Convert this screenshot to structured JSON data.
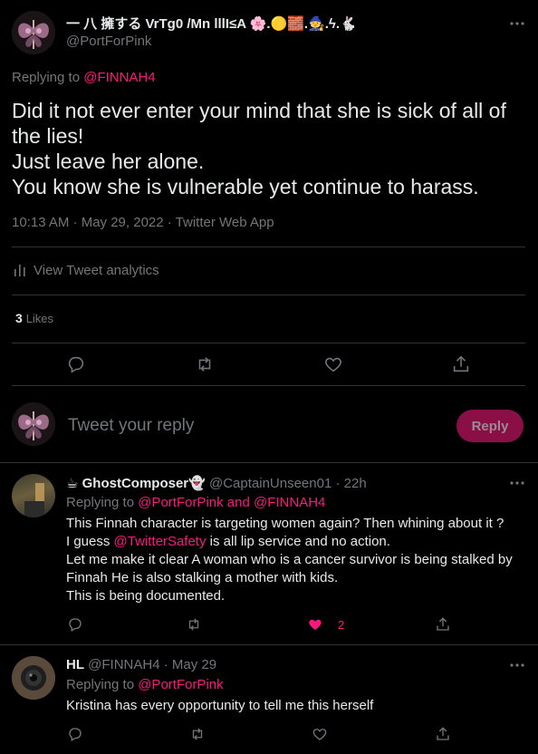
{
  "main_tweet": {
    "display_name": "一 八 擁する VrTg0 /Mn lllI≤A 🌸.🟡🧱.🧙.ϟ.🐇",
    "handle": "@PortForPink",
    "replying_prefix": "Replying to",
    "replying_handle": "@FINNAH4",
    "text_lines": [
      "Did it not ever enter your mind that she is sick of all of",
      "the lies!",
      "Just leave her alone.",
      "You know she is vulnerable yet continue to harass."
    ],
    "meta": "10:13 AM · May 29, 2022 · Twitter Web App",
    "analytics_label": "View Tweet analytics",
    "likes_count": "3",
    "likes_label": "Likes"
  },
  "composer": {
    "placeholder": "Tweet your reply",
    "reply_button": "Reply"
  },
  "replies": [
    {
      "emoji_prefix": "☕",
      "display_name": "GhostComposer👻",
      "handle": "@CaptainUnseen01",
      "time": "· 22h",
      "replying_prefix": "Replying to",
      "replying_handles": "@PortForPink and @FINNAH4",
      "line1": "This Finnah character is targeting women again? Then whining about it ?",
      "line2_pre": "I guess",
      "line2_link": "@TwitterSafety",
      "line2_post": "is all lip service and no action.",
      "line3": "Let me make it clear A woman who is a cancer survivor is being stalked by",
      "line4": "Finnah He is also stalking a mother with kids.",
      "line5": "This is being documented.",
      "like_count": "2",
      "liked": true
    },
    {
      "display_name": "HL",
      "handle": "@FINNAH4",
      "time": "· May 29",
      "replying_prefix": "Replying to",
      "replying_handles": "@PortForPink",
      "line1": "Kristina has every opportunity to tell me this herself",
      "liked": false
    }
  ],
  "colors": {
    "background": "#000000",
    "text": "#e7e9ea",
    "muted": "#71767b",
    "accent": "#f91880",
    "reply_button_bg": "#8a0f47"
  }
}
